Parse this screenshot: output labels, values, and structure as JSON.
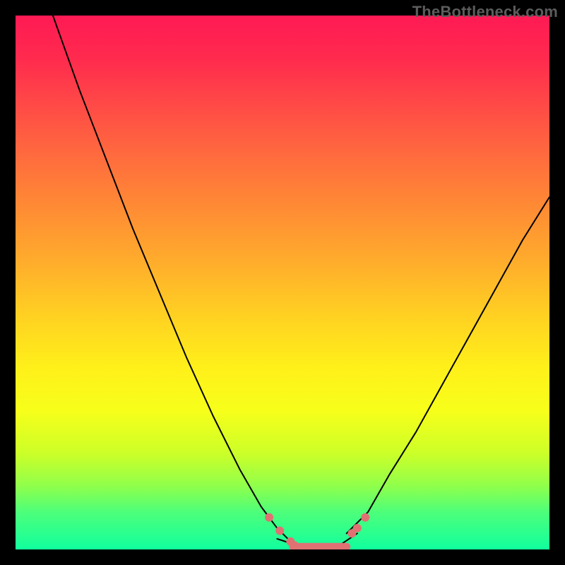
{
  "watermark": "TheBottleneck.com",
  "colors": {
    "frame_border": "#000000",
    "curve_stroke": "#000000",
    "marker_stroke": "#e07173",
    "marker_fill": "#e07173"
  },
  "chart_data": {
    "type": "line",
    "title": "",
    "xlabel": "",
    "ylabel": "",
    "xlim": [
      0,
      100
    ],
    "ylim": [
      0,
      100
    ],
    "note": "No axes or tick labels are rendered in the source image; x/y units are normalized 0–100.",
    "series": [
      {
        "name": "left-curve",
        "x": [
          7,
          12,
          17,
          22,
          27,
          32,
          37,
          42,
          46,
          49,
          51,
          53,
          55
        ],
        "y": [
          100,
          86,
          73,
          60,
          48,
          36,
          25,
          15,
          8,
          4,
          2,
          1,
          0
        ]
      },
      {
        "name": "trough",
        "x": [
          49,
          52,
          55,
          58,
          61,
          64
        ],
        "y": [
          2,
          1,
          0,
          0,
          1,
          3
        ]
      },
      {
        "name": "right-curve",
        "x": [
          62,
          66,
          70,
          75,
          80,
          85,
          90,
          95,
          100
        ],
        "y": [
          3,
          7,
          14,
          22,
          31,
          40,
          49,
          58,
          66
        ]
      }
    ],
    "markers": [
      {
        "name": "left-marker-1",
        "x": 47.5,
        "y": 6
      },
      {
        "name": "left-marker-2",
        "x": 49.5,
        "y": 3.5
      },
      {
        "name": "left-marker-3",
        "x": 51.5,
        "y": 1.5
      },
      {
        "name": "left-marker-4",
        "x": 52.2,
        "y": 0.8
      },
      {
        "name": "right-marker-1",
        "x": 63.0,
        "y": 3
      },
      {
        "name": "right-marker-2",
        "x": 64.0,
        "y": 4
      },
      {
        "name": "right-marker-3",
        "x": 65.5,
        "y": 6
      }
    ],
    "trough_segment": {
      "x1": 52,
      "x2": 62,
      "y": 0.5
    }
  }
}
